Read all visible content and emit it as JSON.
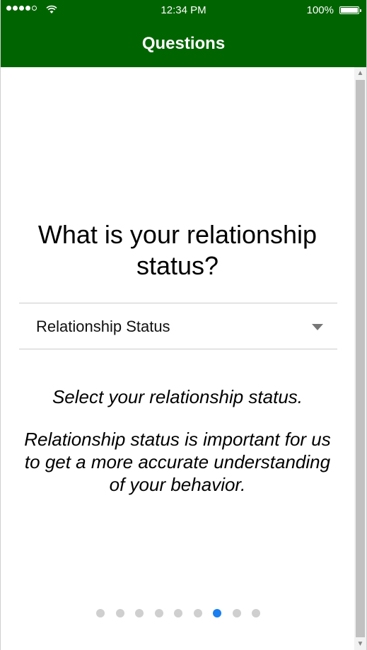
{
  "status_bar": {
    "time": "12:34 PM",
    "battery": "100%"
  },
  "nav": {
    "title": "Questions"
  },
  "question": {
    "title": "What is your relationship status?"
  },
  "dropdown": {
    "label": "Relationship Status"
  },
  "help": {
    "line1": "Select your relationship status.",
    "line2": "Relationship status is important for us to get a more accurate understanding of your behavior."
  },
  "pager": {
    "total": 9,
    "active_index": 6
  },
  "colors": {
    "header": "#006400",
    "active_dot": "#1a7ff0",
    "inactive_dot": "#cfcfcf"
  }
}
